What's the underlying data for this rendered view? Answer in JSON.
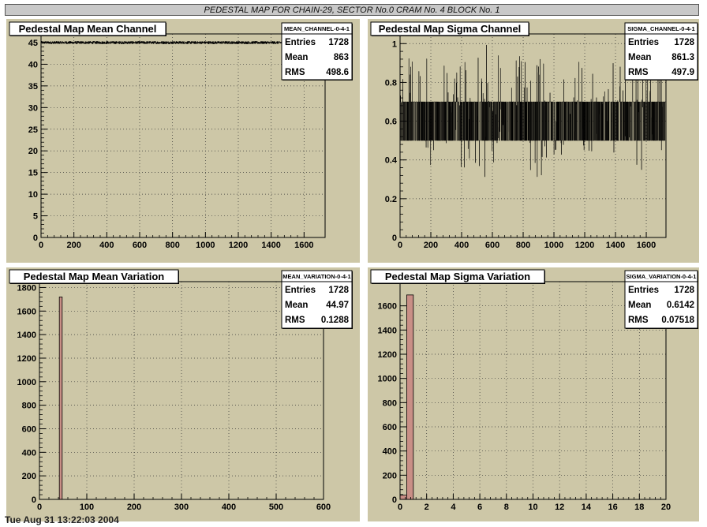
{
  "canvas_title": "PEDESTAL MAP FOR CHAIN-29, SECTOR No.0 CRAM No. 4 BLOCK No. 1",
  "footer_text": "Tue Aug 31 13:22:03 2004",
  "colors": {
    "pad_background": "#cdc7a7",
    "frame_fill": "#ffffff",
    "line": "#000000",
    "bar_fill": "#c98f86",
    "title_box": "#ffffff"
  },
  "chart_data": [
    {
      "type": "line",
      "title": "Pedestal Map Mean Channel",
      "stats": {
        "name": "MEAN_CHANNEL-0-4-1",
        "rows": [
          [
            "Entries",
            "1728"
          ],
          [
            "Mean",
            "863"
          ],
          [
            "RMS",
            "498.6"
          ]
        ]
      },
      "xlim": [
        0,
        1728
      ],
      "ylim": [
        0,
        47
      ],
      "xticks": [
        0,
        200,
        400,
        600,
        800,
        1000,
        1200,
        1400,
        1600
      ],
      "yticks": [
        0,
        5,
        10,
        15,
        20,
        25,
        30,
        35,
        40,
        45
      ],
      "grid": true,
      "series": [
        {
          "shape": "flat-noise",
          "level": 45,
          "band": [
            44.7,
            45.3
          ],
          "n": 1728
        }
      ]
    },
    {
      "type": "line",
      "title": "Pedestal Map Sigma Channel",
      "stats": {
        "name": "SIGMA_CHANNEL-0-4-1",
        "rows": [
          [
            "Entries",
            "1728"
          ],
          [
            "Mean",
            "861.3"
          ],
          [
            "RMS",
            "497.9"
          ]
        ]
      },
      "xlim": [
        0,
        1728
      ],
      "ylim": [
        0,
        1.05
      ],
      "xticks": [
        0,
        200,
        400,
        600,
        800,
        1000,
        1200,
        1400,
        1600
      ],
      "yticks": [
        0,
        0.2,
        0.4,
        0.6,
        0.8,
        1
      ],
      "grid": true,
      "series": [
        {
          "shape": "noise-band",
          "level": 0.6,
          "band": [
            0.5,
            0.7
          ],
          "range": [
            0.31,
            1.0
          ],
          "n": 1728
        }
      ]
    },
    {
      "type": "bar",
      "title": "Pedestal Map Mean Variation",
      "stats": {
        "name": "MEAN_VARIATION-0-4-1",
        "rows": [
          [
            "Entries",
            "1728"
          ],
          [
            "Mean",
            "44.97"
          ],
          [
            "RMS",
            "0.1288"
          ]
        ]
      },
      "xlim": [
        0,
        600
      ],
      "ylim": [
        0,
        1850
      ],
      "xticks": [
        0,
        100,
        200,
        300,
        400,
        500,
        600
      ],
      "yticks": [
        0,
        200,
        400,
        600,
        800,
        1000,
        1200,
        1400,
        1600,
        1800
      ],
      "grid": true,
      "bars": [
        {
          "x0": 42,
          "x1": 48,
          "value": 1720
        }
      ]
    },
    {
      "type": "bar",
      "title": "Pedestal Map Sigma Variation",
      "stats": {
        "name": "SIGMA_VARIATION-0-4-1",
        "rows": [
          [
            "Entries",
            "1728"
          ],
          [
            "Mean",
            "0.6142"
          ],
          [
            "RMS",
            "0.07518"
          ]
        ]
      },
      "xlim": [
        0,
        20
      ],
      "ylim": [
        0,
        1800
      ],
      "xticks": [
        0,
        2,
        4,
        6,
        8,
        10,
        12,
        14,
        16,
        18,
        20
      ],
      "yticks": [
        0,
        200,
        400,
        600,
        800,
        1000,
        1200,
        1400,
        1600
      ],
      "grid": true,
      "bars": [
        {
          "x0": 0,
          "x1": 0.5,
          "value": 35
        },
        {
          "x0": 0.5,
          "x1": 1.0,
          "value": 1690
        }
      ]
    }
  ]
}
